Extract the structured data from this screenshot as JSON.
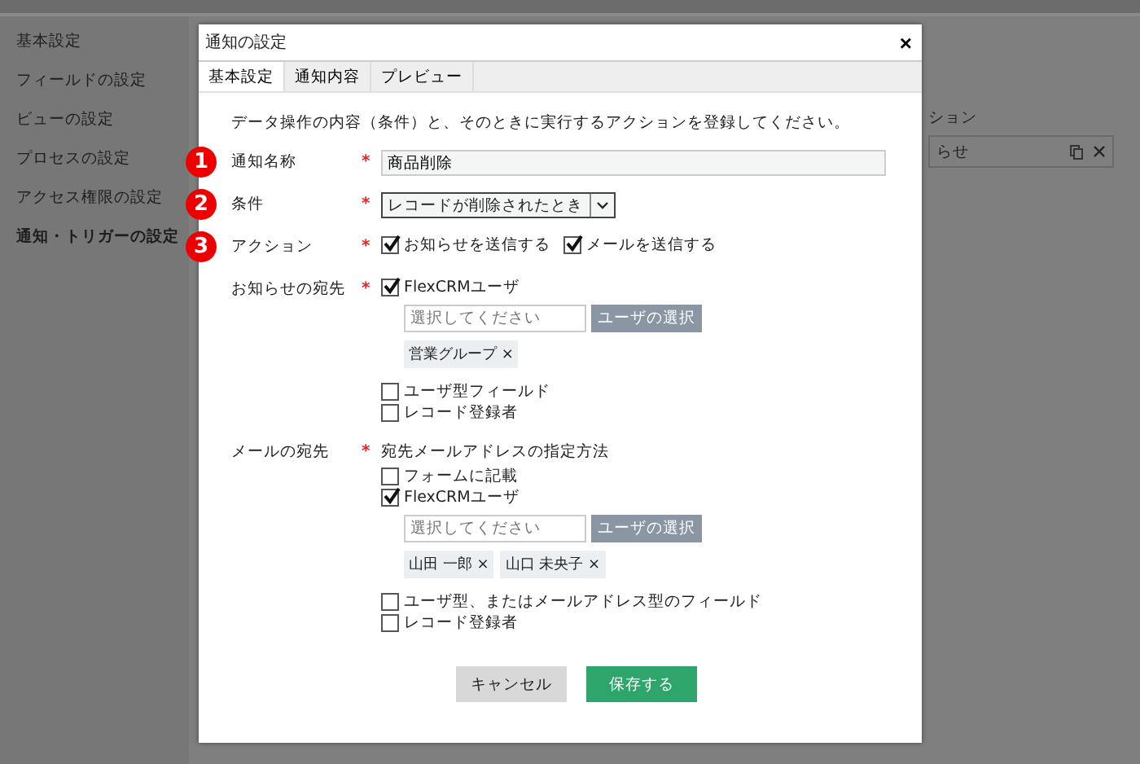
{
  "sidebar": {
    "items": [
      {
        "label": "基本設定",
        "selected": false
      },
      {
        "label": "フィールドの設定",
        "selected": false
      },
      {
        "label": "ビューの設定",
        "selected": false
      },
      {
        "label": "プロセスの設定",
        "selected": false
      },
      {
        "label": "アクセス権限の設定",
        "selected": false
      },
      {
        "label": "通知・トリガーの設定",
        "selected": true
      }
    ]
  },
  "background_list": {
    "header": "ション",
    "rows": [
      {
        "label": "らせ"
      }
    ]
  },
  "dialog": {
    "title": "通知の設定",
    "close": "×",
    "tabs": [
      {
        "label": "基本設定",
        "selected": true
      },
      {
        "label": "通知内容",
        "selected": false
      },
      {
        "label": "プレビュー",
        "selected": false
      }
    ],
    "description": "データ操作の内容（条件）と、そのときに実行するアクションを登録してください。",
    "rows": [
      {
        "kind": "text",
        "badge": "1",
        "label": "通知名称",
        "required_mark": "*",
        "value": "商品削除"
      },
      {
        "kind": "select",
        "badge": "2",
        "label": "条件",
        "required_mark": "*",
        "value": "レコードが削除されたとき"
      },
      {
        "kind": "checks",
        "badge": "3",
        "label": "アクション",
        "required_mark": "*",
        "items": [
          {
            "kind": "check",
            "label": "お知らせを送信する",
            "checked": true
          },
          {
            "kind": "check",
            "label": "メールを送信する",
            "checked": true
          }
        ]
      },
      {
        "kind": "list",
        "label": "お知らせの宛先",
        "required_mark": "*",
        "items": [
          {
            "kind": "users",
            "label": "FlexCRMユーザ",
            "checked": true,
            "placeholder": "選択してください",
            "button": "ユーザの選択",
            "tags": [
              "営業グループ ×"
            ]
          },
          {
            "kind": "check",
            "label": "ユーザ型フィールド",
            "checked": false
          },
          {
            "kind": "check",
            "label": "レコード登録者",
            "checked": false
          }
        ]
      },
      {
        "kind": "list",
        "label": "メールの宛先",
        "required_mark": "*",
        "hint": "宛先メールアドレスの指定方法",
        "items": [
          {
            "kind": "check",
            "label": "フォームに記載",
            "checked": false
          },
          {
            "kind": "users",
            "label": "FlexCRMユーザ",
            "checked": true,
            "placeholder": "選択してください",
            "button": "ユーザの選択",
            "tags": [
              "山田 一郎 ×",
              "山口 未央子 ×"
            ]
          },
          {
            "kind": "check",
            "label": "ユーザ型、またはメールアドレス型のフィールド",
            "checked": false
          },
          {
            "kind": "check",
            "label": "レコード登録者",
            "checked": false
          }
        ]
      }
    ],
    "buttons": [
      {
        "kind": "cancel",
        "label": "キャンセル"
      },
      {
        "kind": "save",
        "label": "保存する"
      }
    ]
  }
}
